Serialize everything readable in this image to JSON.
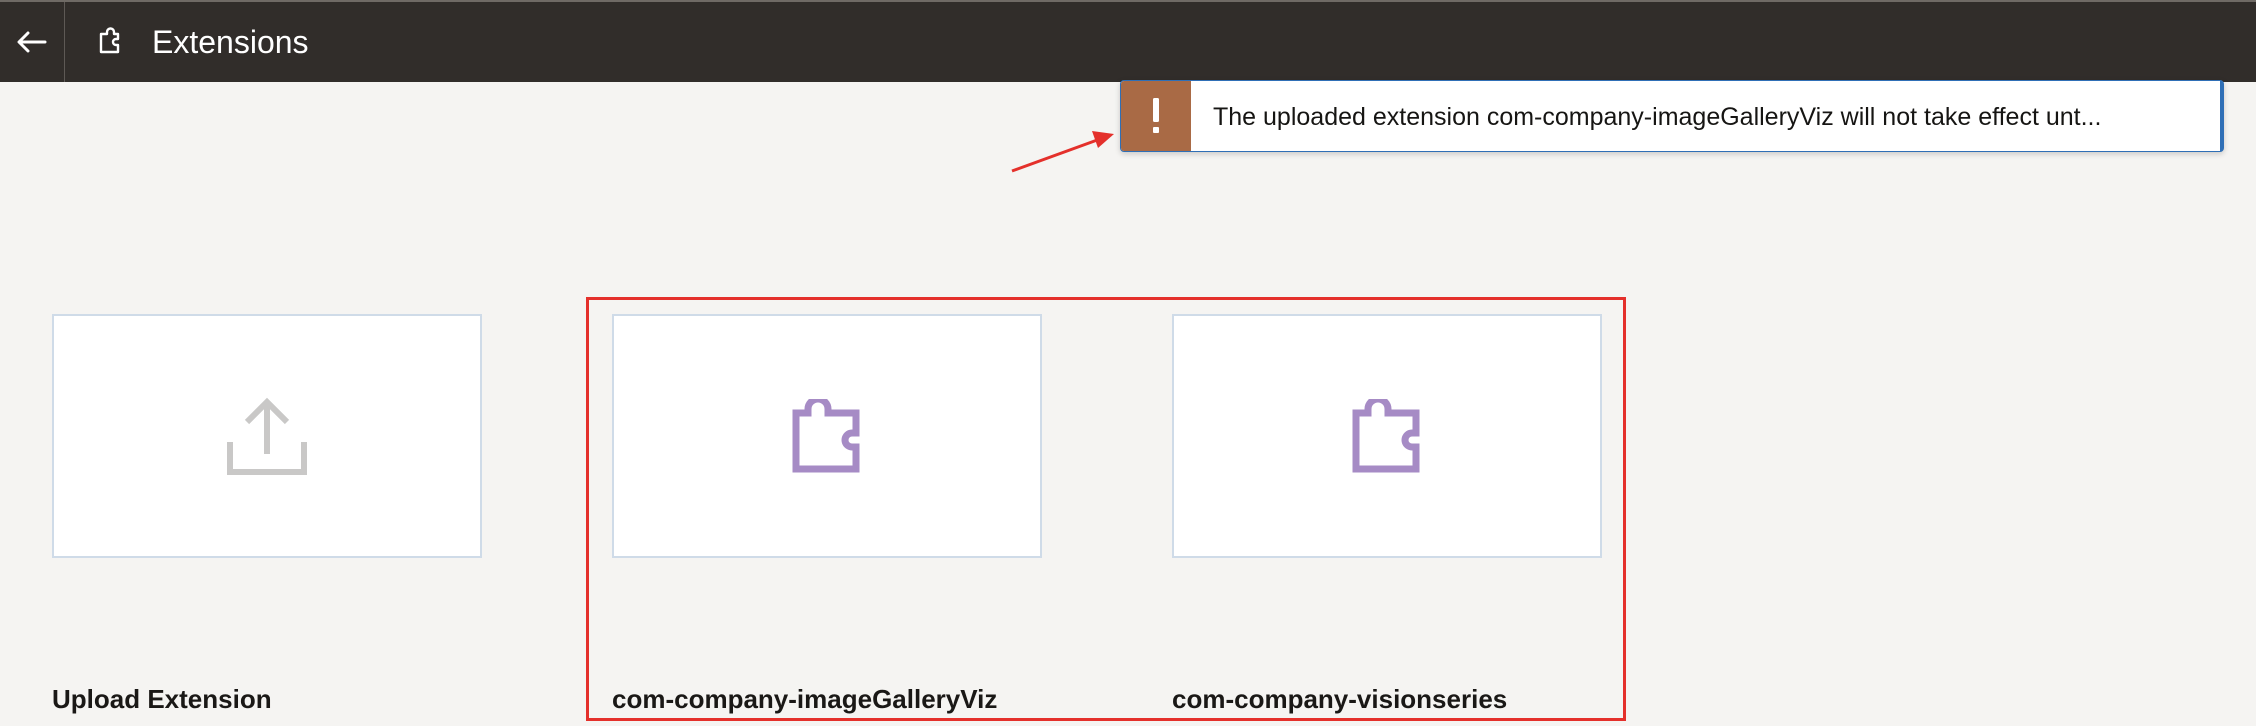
{
  "header": {
    "back_label": "Back",
    "title": "Extensions",
    "background": "#312d2a",
    "title_icon": "puzzle-outline-icon"
  },
  "notification": {
    "message": "The uploaded extension com-company-imageGalleryViz will not take effect unt...",
    "severity_icon": "exclamation-icon",
    "badge_color": "#a96a45",
    "border_color": "#2f6fb6"
  },
  "annotation": {
    "arrow_color": "#e4302b",
    "highlight_color": "#e4302b"
  },
  "extensions": [
    {
      "label": "Upload Extension",
      "icon": "upload-icon"
    },
    {
      "label": "com-company-imageGalleryViz",
      "icon": "puzzle-icon"
    },
    {
      "label": "com-company-visionseries",
      "icon": "puzzle-icon"
    }
  ]
}
